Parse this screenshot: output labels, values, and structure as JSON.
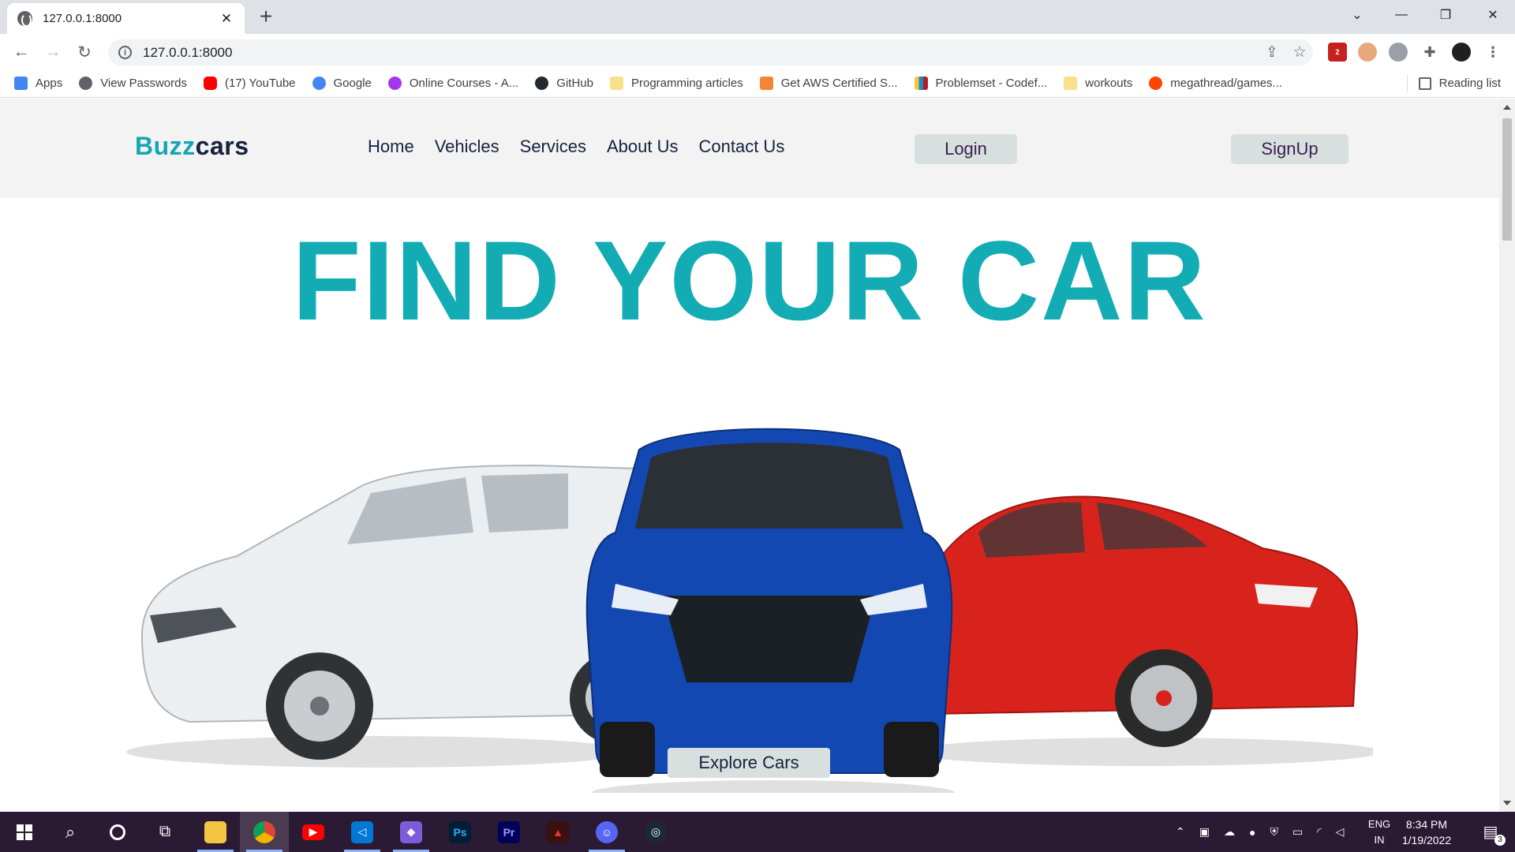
{
  "browser": {
    "tab_title": "127.0.0.1:8000",
    "url": "127.0.0.1:8000",
    "extension_badge": "2"
  },
  "bookmarks": [
    {
      "label": "Apps",
      "icon": "apps-grid-icon",
      "color": "#4285f4"
    },
    {
      "label": "View Passwords",
      "icon": "globe-icon",
      "color": "#5f6368"
    },
    {
      "label": "(17) YouTube",
      "icon": "youtube-icon",
      "color": "#ff0000"
    },
    {
      "label": "Google",
      "icon": "google-icon",
      "color": "#4285f4"
    },
    {
      "label": "Online Courses - A...",
      "icon": "udemy-icon",
      "color": "#a435f0"
    },
    {
      "label": "GitHub",
      "icon": "github-icon",
      "color": "#24292f"
    },
    {
      "label": "Programming articles",
      "icon": "folder-icon",
      "color": "#f9e08a"
    },
    {
      "label": "Get AWS Certified S...",
      "icon": "aws-cube-icon",
      "color": "#f58536"
    },
    {
      "label": "Problemset - Codef...",
      "icon": "codeforces-icon",
      "color": "#1f8acb"
    },
    {
      "label": "workouts",
      "icon": "folder-icon",
      "color": "#f9e08a"
    },
    {
      "label": "megathread/games...",
      "icon": "reddit-icon",
      "color": "#ff4500"
    }
  ],
  "reading_list": "Reading list",
  "site": {
    "brand_a": "Buzz",
    "brand_b": "cars",
    "nav": [
      "Home",
      "Vehicles",
      "Services",
      "About Us",
      "Contact Us"
    ],
    "login": "Login",
    "signup": "SignUp",
    "hero": "FIND YOUR CAR",
    "cta": "Explore Cars",
    "colors": {
      "accent": "#13acb5",
      "dark": "#16213e",
      "button_bg": "#d8e0df"
    }
  },
  "taskbar": {
    "lang_top": "ENG",
    "lang_bottom": "IN",
    "time": "8:34 PM",
    "date": "1/19/2022",
    "notification_count": "3"
  }
}
